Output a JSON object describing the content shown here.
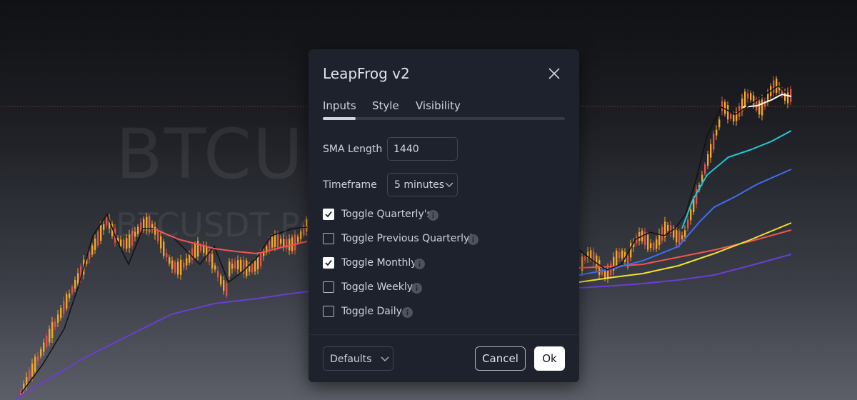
{
  "background_chart": {
    "watermark_symbol": "BTCUS",
    "watermark_subtitle": "BTCUSDT  Per"
  },
  "dialog": {
    "title": "LeapFrog v2",
    "tabs": [
      {
        "label": "Inputs",
        "active": true
      },
      {
        "label": "Style",
        "active": false
      },
      {
        "label": "Visibility",
        "active": false
      }
    ],
    "sma_length": {
      "label": "SMA Length",
      "value": "1440"
    },
    "timeframe": {
      "label": "Timeframe",
      "value": "5 minutes"
    },
    "toggles": [
      {
        "label": "Toggle Quarterly's",
        "checked": true
      },
      {
        "label": "Toggle Previous Quarterly's",
        "checked": false
      },
      {
        "label": "Toggle Monthly",
        "checked": true
      },
      {
        "label": "Toggle Weekly",
        "checked": false
      },
      {
        "label": "Toggle Daily",
        "checked": false
      }
    ],
    "footer": {
      "defaults_label": "Defaults",
      "cancel_label": "Cancel",
      "ok_label": "Ok"
    }
  },
  "icons": {
    "close": "close-icon",
    "chevron": "chevron-down-icon",
    "info": "info-icon"
  },
  "colors": {
    "dialog_bg": "#1e222d",
    "candle_up": "#f5a623",
    "candle_down": "#e05252",
    "line_red": "#f05454",
    "line_purple": "#6a3fd0",
    "line_cyan": "#1fc8d8",
    "line_blue": "#3d6ff0",
    "line_yellow": "#f2e12e",
    "line_white": "#ffffff"
  }
}
